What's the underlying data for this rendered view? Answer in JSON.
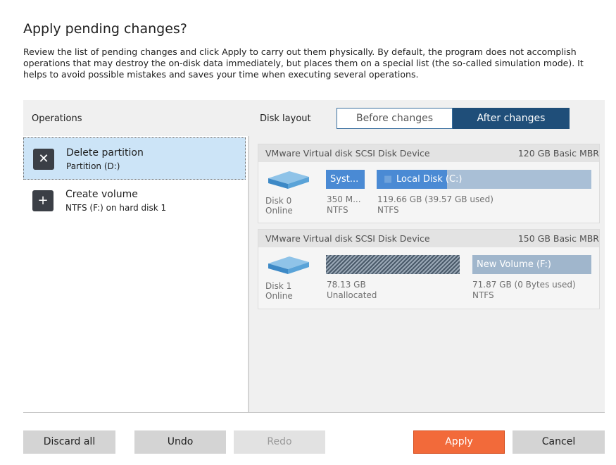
{
  "dialog": {
    "title": "Apply pending changes?",
    "description": "Review the list of pending changes and click Apply to carry out them physically. By default, the program does not accomplish operations that may destroy the on-disk data immediately, but places them on a special list (the so-called simulation mode). It helps to avoid possible mistakes and saves your time when executing several operations."
  },
  "operations": {
    "header": "Operations",
    "items": [
      {
        "icon": "close-icon",
        "glyph": "✕",
        "title": "Delete partition",
        "subtitle": "Partition (D:)",
        "selected": true
      },
      {
        "icon": "plus-icon",
        "glyph": "+",
        "title": "Create volume",
        "subtitle": "NTFS (F:) on hard disk 1",
        "selected": false
      }
    ]
  },
  "disk_layout": {
    "label": "Disk layout",
    "tabs": {
      "before": "Before changes",
      "after": "After changes",
      "active": "after"
    },
    "disks": [
      {
        "name": "VMware Virtual disk SCSI Disk Device",
        "info": "120 GB Basic MBR",
        "disk_label": "Disk 0",
        "status": "Online",
        "partitions": [
          {
            "label": "Syst...",
            "size": "350 M...",
            "fs": "NTFS",
            "color": "#4a8ad4"
          },
          {
            "label": "Local Disk (C:)",
            "size": "119.66 GB (39.57 GB used)",
            "fs": "NTFS",
            "color": "#a9bfd6",
            "used_fraction": 0.33
          }
        ]
      },
      {
        "name": "VMware Virtual disk SCSI Disk Device",
        "info": "150 GB Basic MBR",
        "disk_label": "Disk 1",
        "status": "Online",
        "partitions": [
          {
            "label": "",
            "size": "78.13 GB",
            "fs": "Unallocated"
          },
          {
            "label": "New Volume (F:)",
            "size": "71.87 GB (0 Bytes used)",
            "fs": "NTFS",
            "color": "#a0b6cc"
          }
        ]
      }
    ]
  },
  "buttons": {
    "discard_all": "Discard all",
    "undo": "Undo",
    "redo": "Redo",
    "apply": "Apply",
    "cancel": "Cancel"
  }
}
